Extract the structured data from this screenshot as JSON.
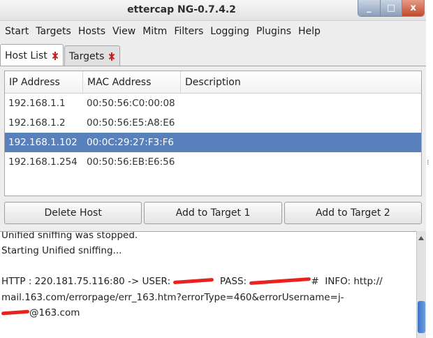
{
  "window": {
    "title": "ettercap NG-0.7.4.2"
  },
  "wm_buttons": {
    "minimize": "_",
    "maximize": "□",
    "close": "x"
  },
  "menu": [
    "Start",
    "Targets",
    "Hosts",
    "View",
    "Mitm",
    "Filters",
    "Logging",
    "Plugins",
    "Help"
  ],
  "tabs": [
    {
      "label": "Host List",
      "active": true,
      "close_icon": "close-tab-icon"
    },
    {
      "label": "Targets",
      "active": false,
      "close_icon": "close-tab-icon"
    }
  ],
  "host_table": {
    "columns": [
      "IP Address",
      "MAC Address",
      "Description"
    ],
    "rows": [
      {
        "ip": "192.168.1.1",
        "mac": "00:50:56:C0:00:08",
        "desc": ""
      },
      {
        "ip": "192.168.1.2",
        "mac": "00:50:56:E5:A8:E6",
        "desc": ""
      },
      {
        "ip": "192.168.1.102",
        "mac": "00:0C:29:27:F3:F6",
        "desc": "",
        "selected": true
      },
      {
        "ip": "192.168.1.254",
        "mac": "00:50:56:EB:E6:56",
        "desc": ""
      }
    ]
  },
  "buttons": {
    "delete_host": "Delete Host",
    "add_target_1": "Add to Target 1",
    "add_target_2": "Add to Target 2"
  },
  "log": {
    "line1": "Unified sniffing was stopped.",
    "line2": "Starting Unified sniffing...",
    "line3_prefix": "HTTP : 220.181.75.116:80 -> USER: ",
    "line3_pass": "  PASS: ",
    "line3_hash": "#  INFO: http://",
    "line4": "mail.163.com/errorpage/err_163.htm?errorType=460&errorUsername=j-",
    "line5_suffix": "@163.com"
  },
  "colors": {
    "selection": "#5780bd",
    "redaction": "#e8231f",
    "scroll_thumb": "#3b75c8"
  }
}
